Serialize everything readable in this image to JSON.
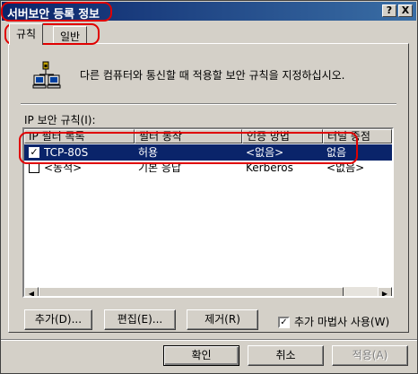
{
  "window": {
    "title": "서버보안 등록 정보",
    "help_button": "?",
    "close_button": "X"
  },
  "tabs": [
    {
      "label": "규칙",
      "active": true
    },
    {
      "label": "일반",
      "active": false
    }
  ],
  "description": "다른 컴퓨터와 통신할 때 적용할 보안 규칙을 지정하십시오.",
  "rules": {
    "label": "IP 보안 규칙(I):",
    "columns": [
      "IP 필터 목록",
      "필터 동작",
      "인증 방법",
      "터널 종점"
    ],
    "rows": [
      {
        "checked": true,
        "selected": true,
        "cells": [
          "TCP-80S",
          "허용",
          "<없음>",
          "없음"
        ]
      },
      {
        "checked": false,
        "selected": false,
        "cells": [
          "<동적>",
          "기본 응답",
          "Kerberos",
          "<없음>"
        ]
      }
    ]
  },
  "buttons": {
    "add": "추가(D)...",
    "edit": "편집(E)...",
    "remove": "제거(R)",
    "ok": "확인",
    "cancel": "취소",
    "apply": "적용(A)"
  },
  "wizard_checkbox": {
    "label": "추가 마법사 사용(W)",
    "checked": true
  },
  "colors": {
    "selection": "#0a246a",
    "highlight_oval": "#e00000",
    "dialog_face": "#d4d0c8"
  }
}
